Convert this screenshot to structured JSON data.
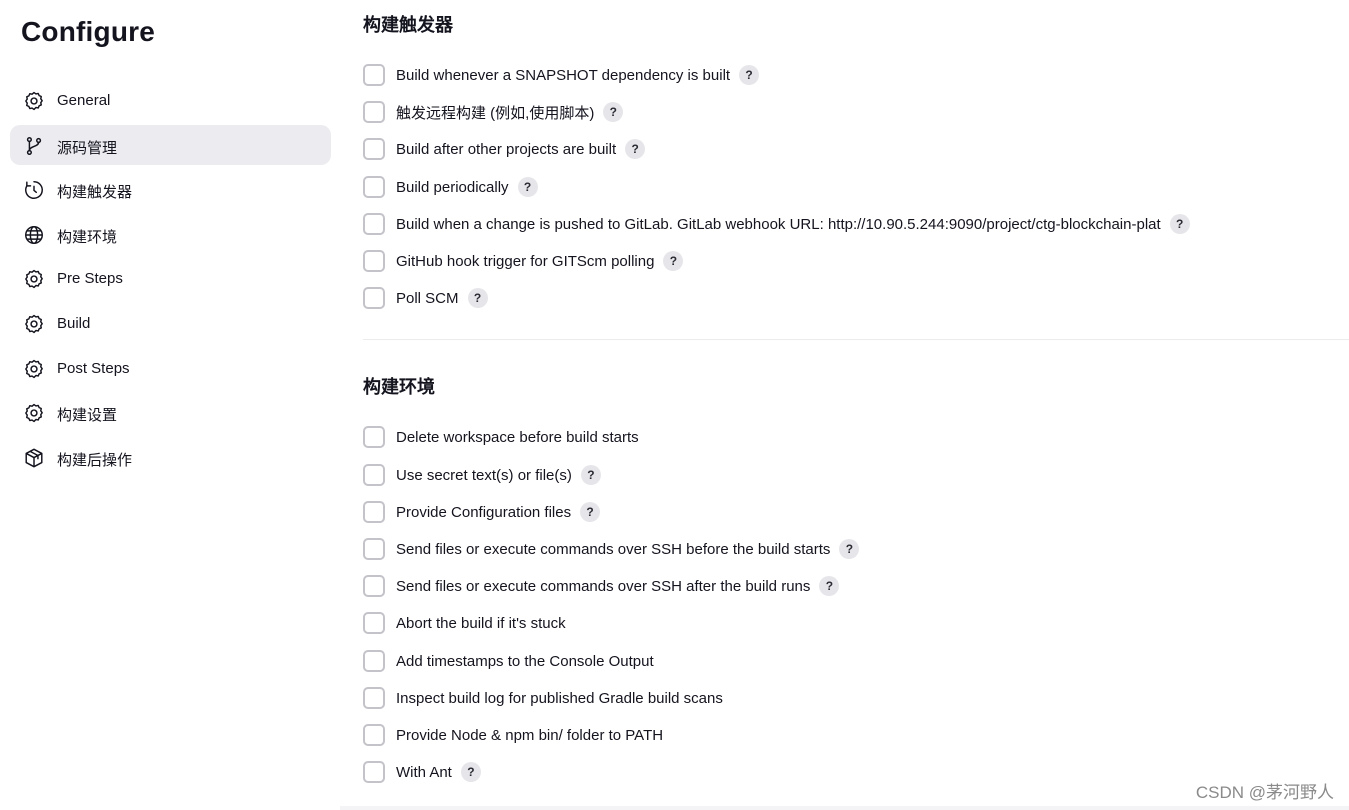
{
  "page": {
    "title": "Configure"
  },
  "sidebar": {
    "items": [
      {
        "label": "General",
        "icon": "gear-icon",
        "active": false
      },
      {
        "label": "源码管理",
        "icon": "git-branch-icon",
        "active": true
      },
      {
        "label": "构建触发器",
        "icon": "clock-icon",
        "active": false
      },
      {
        "label": "构建环境",
        "icon": "globe-icon",
        "active": false
      },
      {
        "label": "Pre Steps",
        "icon": "gear-icon",
        "active": false
      },
      {
        "label": "Build",
        "icon": "gear-icon",
        "active": false
      },
      {
        "label": "Post Steps",
        "icon": "gear-icon",
        "active": false
      },
      {
        "label": "构建设置",
        "icon": "gear-icon",
        "active": false
      },
      {
        "label": "构建后操作",
        "icon": "cube-icon",
        "active": false
      }
    ]
  },
  "triggers": {
    "title": "构建触发器",
    "options": [
      {
        "label": "Build whenever a SNAPSHOT dependency is built",
        "help": true,
        "checked": false
      },
      {
        "label": "触发远程构建 (例如,使用脚本)",
        "help": true,
        "checked": false
      },
      {
        "label": "Build after other projects are built",
        "help": true,
        "checked": false
      },
      {
        "label": "Build periodically",
        "help": true,
        "checked": false
      },
      {
        "label": "Build when a change is pushed to GitLab. GitLab webhook URL: http://10.90.5.244:9090/project/ctg-blockchain-plat",
        "help": true,
        "checked": false
      },
      {
        "label": "GitHub hook trigger for GITScm polling",
        "help": true,
        "checked": false
      },
      {
        "label": "Poll SCM",
        "help": true,
        "checked": false
      }
    ]
  },
  "environment": {
    "title": "构建环境",
    "options": [
      {
        "label": "Delete workspace before build starts",
        "help": false,
        "checked": false
      },
      {
        "label": "Use secret text(s) or file(s)",
        "help": true,
        "checked": false
      },
      {
        "label": "Provide Configuration files",
        "help": true,
        "checked": false
      },
      {
        "label": "Send files or execute commands over SSH before the build starts",
        "help": true,
        "checked": false
      },
      {
        "label": "Send files or execute commands over SSH after the build runs",
        "help": true,
        "checked": false
      },
      {
        "label": "Abort the build if it's stuck",
        "help": false,
        "checked": false
      },
      {
        "label": "Add timestamps to the Console Output",
        "help": false,
        "checked": false
      },
      {
        "label": "Inspect build log for published Gradle build scans",
        "help": false,
        "checked": false
      },
      {
        "label": "Provide Node & npm bin/ folder to PATH",
        "help": false,
        "checked": false
      },
      {
        "label": "With Ant",
        "help": true,
        "checked": false
      }
    ]
  },
  "help_glyph": "?",
  "watermark": "CSDN @茅河野人"
}
